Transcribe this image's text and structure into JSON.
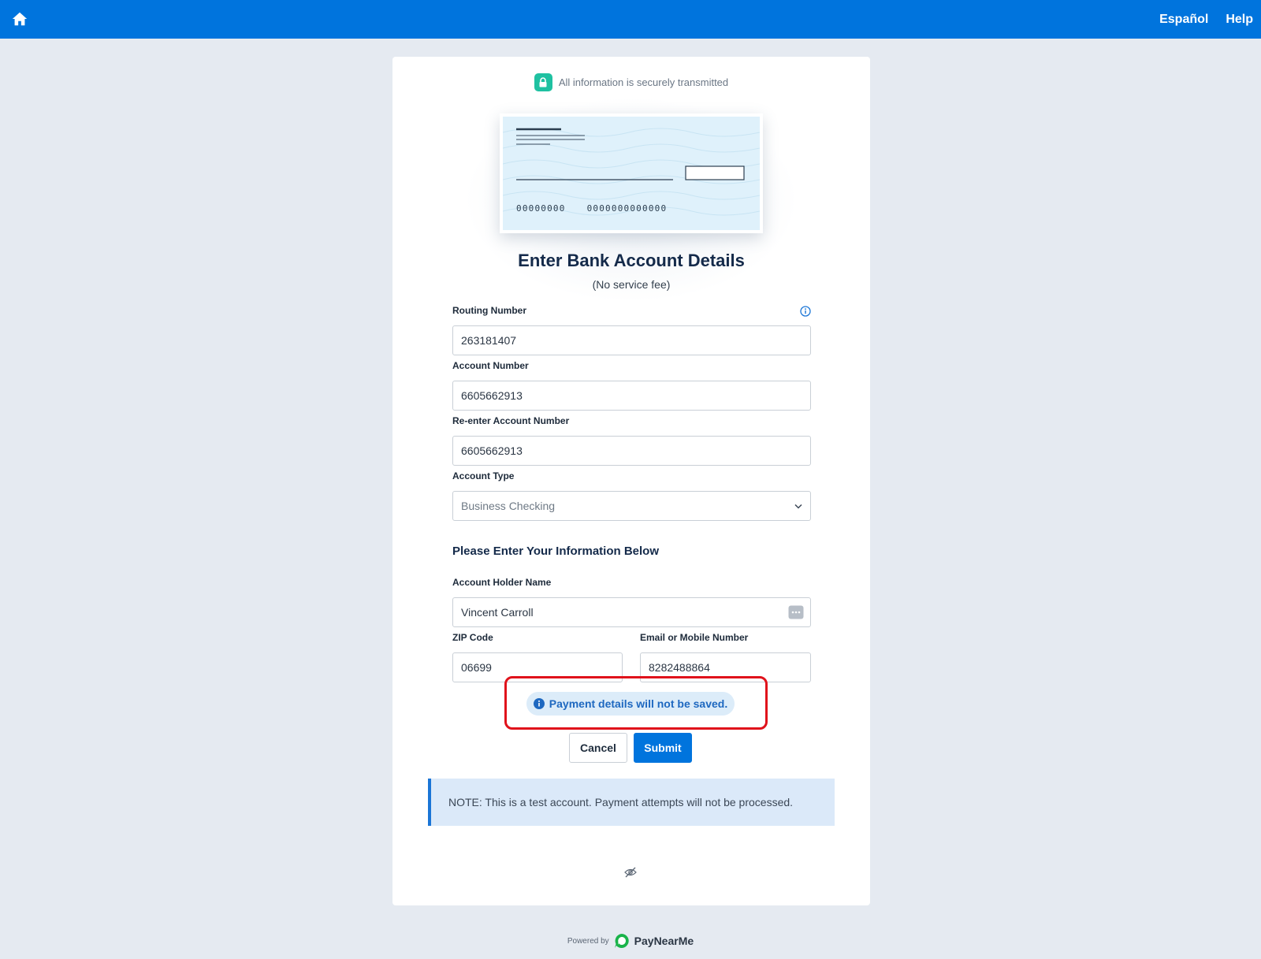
{
  "header": {
    "language_link": "Español",
    "help_link": "Help",
    "brand_color": "#0074dd"
  },
  "security": {
    "text": "All information is securely transmitted"
  },
  "check_image": {
    "routing_placeholder": "00000000",
    "account_placeholder": "0000000000000"
  },
  "page": {
    "title": "Enter Bank Account Details",
    "subtitle": "(No service fee)"
  },
  "form": {
    "routing_label": "Routing Number",
    "routing_value": "263181407",
    "account_label": "Account Number",
    "account_value": "6605662913",
    "reenter_label": "Re-enter Account Number",
    "reenter_value": "6605662913",
    "type_label": "Account Type",
    "type_value": "Business Checking",
    "info_heading": "Please Enter Your Information Below",
    "holder_label": "Account Holder Name",
    "holder_value": "Vincent Carroll",
    "zip_label": "ZIP Code",
    "zip_value": "06699",
    "contact_label": "Email or Mobile Number",
    "contact_value": "8282488864"
  },
  "notice": {
    "text": "Payment details will not be saved.",
    "highlight_color": "#e0121b"
  },
  "actions": {
    "cancel_label": "Cancel",
    "submit_label": "Submit"
  },
  "note": {
    "text": "NOTE: This is a test account. Payment attempts will not be processed."
  },
  "footer": {
    "powered_by": "Powered by",
    "brand": "PayNearMe",
    "brand_color": "#19b34a"
  }
}
